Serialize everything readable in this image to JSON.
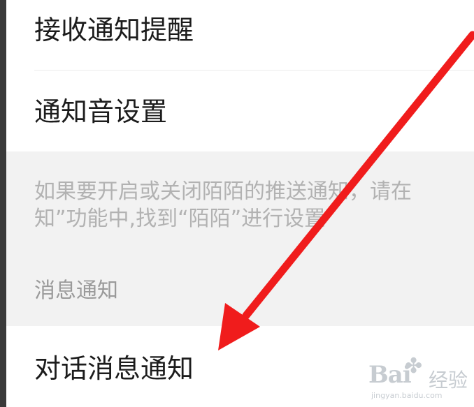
{
  "settings": {
    "rows": [
      {
        "label": "接收通知提醒"
      },
      {
        "label": "通知音设置"
      }
    ],
    "hint_line1": "如果要开启或关闭陌陌的推送通知，请在",
    "hint_line2": "知”功能中,找到“陌陌”进行设置",
    "section_title": "消息通知",
    "message_row_label": "对话消息通知"
  },
  "annotation": {
    "arrow_color": "#f01c1c"
  },
  "watermark": {
    "brand": "Bai",
    "suffix": "经验",
    "url": "jingyan.baidu.com"
  }
}
